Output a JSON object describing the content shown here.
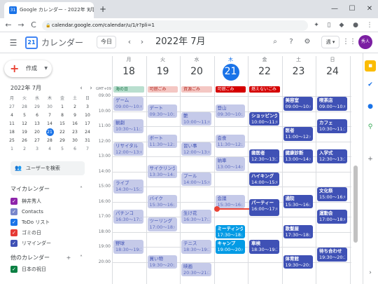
{
  "browser": {
    "tab_title": "Google カレンダー - 2022年 7月 18日",
    "tab_close": "×",
    "newtab": "+",
    "url": "calendar.google.com/calendar/u/1/r?pli=1",
    "back": "←",
    "forward": "→",
    "reload": "C",
    "min": "—",
    "max": "☐",
    "close": "✕"
  },
  "header": {
    "app_name": "カレンダー",
    "today_label": "今日",
    "month_title": "2022年 7月",
    "view_label": "週 ▾",
    "avatar_text": "秀人",
    "logo_num": "21"
  },
  "sidebar": {
    "create_label": "作成",
    "mini_month": "2022年 7月",
    "mini_dow": [
      "月",
      "火",
      "水",
      "木",
      "金",
      "土",
      "日"
    ],
    "mini_days": [
      "27",
      "28",
      "29",
      "30",
      "1",
      "2",
      "3",
      "4",
      "5",
      "6",
      "7",
      "8",
      "9",
      "10",
      "11",
      "12",
      "13",
      "14",
      "15",
      "16",
      "17",
      "18",
      "19",
      "20",
      "21",
      "22",
      "23",
      "24",
      "25",
      "26",
      "27",
      "28",
      "29",
      "30",
      "31",
      "1",
      "2",
      "3",
      "4",
      "5",
      "6",
      "7"
    ],
    "people_search": "ユーザーを検索",
    "my_calendars_title": "マイカレンダー",
    "my_calendars": [
      {
        "name": "榊井秀人",
        "color": "#8e24aa"
      },
      {
        "name": "Contacts",
        "color": "#7986cb"
      },
      {
        "name": "ToDo リスト",
        "color": "#1a73e8"
      },
      {
        "name": "ゴミの日",
        "color": "#e53935"
      },
      {
        "name": "リマインダー",
        "color": "#3f51b5"
      }
    ],
    "other_calendars_title": "他のカレンダー",
    "other_calendars": [
      {
        "name": "日本の祝日",
        "color": "#0b8043"
      }
    ]
  },
  "week": {
    "gmt": "GMT+09",
    "days": [
      {
        "dow": "月",
        "num": "18"
      },
      {
        "dow": "火",
        "num": "19"
      },
      {
        "dow": "水",
        "num": "20"
      },
      {
        "dow": "木",
        "num": "21"
      },
      {
        "dow": "金",
        "num": "22"
      },
      {
        "dow": "土",
        "num": "23"
      },
      {
        "dow": "日",
        "num": "24"
      }
    ],
    "hours": [
      "09:00",
      "10:00",
      "11:00",
      "12:00",
      "13:00",
      "14:00",
      "15:00",
      "16:00",
      "17:00",
      "18:00",
      "19:00",
      "20:00"
    ],
    "allday": [
      {
        "day": 0,
        "title": "海の日",
        "bg": "#b9dfcf",
        "fg": "#0b6b3a"
      },
      {
        "day": 1,
        "title": "可燃ごみ",
        "bg": "#f4c7c3",
        "fg": "#b3261e"
      },
      {
        "day": 2,
        "title": "資源ごみ",
        "bg": "#f4c7c3",
        "fg": "#b3261e"
      },
      {
        "day": 3,
        "title": "可燃ごみ",
        "bg": "#d50000",
        "fg": "#ffffff"
      },
      {
        "day": 4,
        "title": "燃えないごみ",
        "bg": "#d50000",
        "fg": "#ffffff"
      }
    ],
    "events": [
      {
        "day": 0,
        "start": 9.0,
        "end": 10.0,
        "title": "ゲーム",
        "time": "09:00～10:00",
        "style": "light"
      },
      {
        "day": 0,
        "start": 10.5,
        "end": 11.5,
        "title": "観劇",
        "time": "10:30～11:30",
        "style": "light"
      },
      {
        "day": 0,
        "start": 12.0,
        "end": 13.0,
        "title": "リサイタル",
        "time": "12:00～13:00",
        "style": "light"
      },
      {
        "day": 0,
        "start": 14.5,
        "end": 15.5,
        "title": "ライブ",
        "time": "14:30～15:30",
        "style": "light"
      },
      {
        "day": 0,
        "start": 16.5,
        "end": 17.5,
        "title": "パチンコ",
        "time": "16:30～17:30",
        "style": "light"
      },
      {
        "day": 0,
        "start": 18.5,
        "end": 19.5,
        "title": "野球",
        "time": "18:30～19:30",
        "style": "light"
      },
      {
        "day": 1,
        "start": 9.5,
        "end": 10.5,
        "title": "デート",
        "time": "09:30～10:30",
        "style": "light"
      },
      {
        "day": 1,
        "start": 11.5,
        "end": 12.5,
        "title": "ボート",
        "time": "11:30～12:30",
        "style": "light"
      },
      {
        "day": 1,
        "start": 13.5,
        "end": 14.5,
        "title": "サイクリング",
        "time": "13:30～14:30",
        "style": "light"
      },
      {
        "day": 1,
        "start": 15.5,
        "end": 16.5,
        "title": "バイク",
        "time": "15:30～16:30",
        "style": "light"
      },
      {
        "day": 1,
        "start": 17.0,
        "end": 18.0,
        "title": "ツーリング",
        "time": "17:00～18:00",
        "style": "light"
      },
      {
        "day": 1,
        "start": 19.5,
        "end": 20.5,
        "title": "買い物",
        "time": "19:30～20:30",
        "style": "light"
      },
      {
        "day": 2,
        "start": 10.0,
        "end": 11.0,
        "title": "艶",
        "time": "10:00～11:00",
        "style": "light"
      },
      {
        "day": 2,
        "start": 12.0,
        "end": 13.0,
        "title": "習い事",
        "time": "12:00～13:00",
        "style": "light"
      },
      {
        "day": 2,
        "start": 14.0,
        "end": 15.0,
        "title": "プール",
        "time": "14:00～15:00",
        "style": "light"
      },
      {
        "day": 2,
        "start": 16.5,
        "end": 17.5,
        "title": "生け花",
        "time": "16:30～17:30",
        "style": "light"
      },
      {
        "day": 2,
        "start": 18.5,
        "end": 19.5,
        "title": "テニス",
        "time": "18:30～19:30",
        "style": "light"
      },
      {
        "day": 2,
        "start": 20.0,
        "end": 21.0,
        "title": "映画",
        "time": "20:30～21:30",
        "style": "light"
      },
      {
        "day": 3,
        "start": 9.5,
        "end": 10.5,
        "title": "登山",
        "time": "09:30～10:30",
        "style": "light"
      },
      {
        "day": 3,
        "start": 11.5,
        "end": 12.5,
        "title": "会食",
        "time": "11:30～12:30",
        "style": "light"
      },
      {
        "day": 3,
        "start": 13.0,
        "end": 14.0,
        "title": "納車",
        "time": "13:00～14:00",
        "style": "light"
      },
      {
        "day": 3,
        "start": 15.5,
        "end": 16.5,
        "title": "会議",
        "time": "15:30～16:30",
        "style": "light"
      },
      {
        "day": 3,
        "start": 17.5,
        "end": 18.5,
        "title": "ミーティング",
        "time": "17:30～18:30",
        "style": "teal"
      },
      {
        "day": 3,
        "start": 18.5,
        "end": 19.5,
        "title": "キャンプ",
        "time": "19:00～20:00",
        "style": "teal"
      },
      {
        "day": 4,
        "start": 10.0,
        "end": 11.0,
        "title": "ショッピング",
        "time": "10:00～11:00",
        "style": "dark"
      },
      {
        "day": 4,
        "start": 12.5,
        "end": 13.5,
        "title": "歯医者",
        "time": "12:30～13:30",
        "style": "dark"
      },
      {
        "day": 4,
        "start": 14.0,
        "end": 15.0,
        "title": "ハイキング",
        "time": "14:00～15:00",
        "style": "dark"
      },
      {
        "day": 4,
        "start": 15.8,
        "end": 17.0,
        "title": "パーティー",
        "time": "16:00～17:00",
        "style": "dark"
      },
      {
        "day": 4,
        "start": 18.5,
        "end": 19.5,
        "title": "車検",
        "time": "18:30～19:30",
        "style": "dark"
      },
      {
        "day": 5,
        "start": 9.0,
        "end": 10.0,
        "title": "美容室",
        "time": "09:00～10:00",
        "style": "dark"
      },
      {
        "day": 5,
        "start": 11.0,
        "end": 12.0,
        "title": "医者",
        "time": "11:00～12:00",
        "style": "dark"
      },
      {
        "day": 5,
        "start": 12.5,
        "end": 13.5,
        "title": "健康診断",
        "time": "13:00～14:00",
        "style": "dark"
      },
      {
        "day": 5,
        "start": 15.5,
        "end": 16.5,
        "title": "通院",
        "time": "15:30～16:30",
        "style": "dark"
      },
      {
        "day": 5,
        "start": 17.5,
        "end": 18.5,
        "title": "散髪屋",
        "time": "17:30～18:30",
        "style": "dark"
      },
      {
        "day": 5,
        "start": 19.5,
        "end": 20.5,
        "title": "体育館",
        "time": "19:30～20:30",
        "style": "dark"
      },
      {
        "day": 6,
        "start": 9.0,
        "end": 10.0,
        "title": "喫茶店",
        "time": "09:00～10:00",
        "style": "dark"
      },
      {
        "day": 6,
        "start": 10.5,
        "end": 11.5,
        "title": "カフェ",
        "time": "10:30～11:30",
        "style": "dark"
      },
      {
        "day": 6,
        "start": 12.5,
        "end": 13.5,
        "title": "入学式",
        "time": "12:30～13:30",
        "style": "dark"
      },
      {
        "day": 6,
        "start": 15.0,
        "end": 16.0,
        "title": "文化祭",
        "time": "15:00～16:00",
        "style": "dark"
      },
      {
        "day": 6,
        "start": 16.5,
        "end": 17.5,
        "title": "運動会",
        "time": "17:00～18:00",
        "style": "dark"
      },
      {
        "day": 6,
        "start": 19.0,
        "end": 20.0,
        "title": "待ち合わせ",
        "time": "19:30～20:30",
        "style": "dark"
      }
    ]
  }
}
